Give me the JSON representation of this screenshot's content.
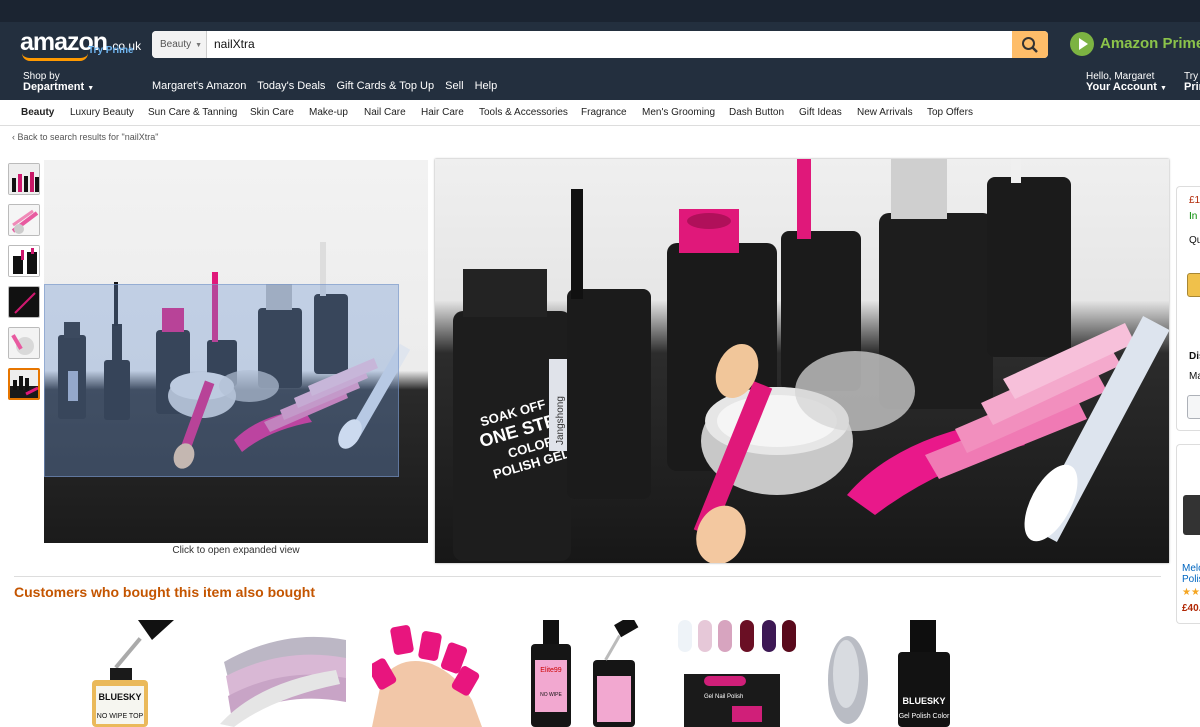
{
  "header": {
    "logo_text": "amazon",
    "logo_tld": ".co.uk",
    "try_prime": "Try Prime",
    "search_category": "Beauty",
    "search_query": "nailXtra",
    "prime_label": "Amazon Prime",
    "shop_by_small": "Shop by",
    "shop_by_big": "Department",
    "nav_links": [
      "Margaret's Amazon",
      "Today's Deals",
      "Gift Cards & Top Up",
      "Sell",
      "Help"
    ],
    "account_small": "Hello, Margaret",
    "account_big": "Your Account",
    "try_small": "Try",
    "try_big": "Prime"
  },
  "subnav": [
    "Beauty",
    "Luxury Beauty",
    "Sun Care & Tanning",
    "Skin Care",
    "Make-up",
    "Nail Care",
    "Hair Care",
    "Tools & Accessories",
    "Fragrance",
    "Men's Grooming",
    "Dash Button",
    "Gift Ideas",
    "New Arrivals",
    "Top Offers"
  ],
  "breadcrumb": "‹  Back to search results for \"nailXtra\"",
  "product": {
    "click_to_expand": "Click to open expanded view",
    "bottle_label_line1": "SOAK OFF",
    "bottle_label_line2": "ONE STEP",
    "bottle_label_line3": "COLOR",
    "bottle_label_line4": "POLISH GEL",
    "bottle_brand": "Jangshong"
  },
  "buybox": {
    "price": "£1",
    "stock": "In",
    "qty": "Qu",
    "d1": "Dis",
    "d2": "Ma"
  },
  "ad": {
    "title1": "Melo",
    "title2": "Polis",
    "price": "£40."
  },
  "customers_title": "Customers who bought this item also bought",
  "recs": [
    {
      "brand": "BLUESKY",
      "sub": "NO WIPE TOP"
    },
    {
      "brand": "",
      "sub": ""
    },
    {
      "brand": "",
      "sub": ""
    },
    {
      "brand": "Elite99",
      "sub": "NO WIPE"
    },
    {
      "brand": "Gel Nail Polish",
      "sub": ""
    },
    {
      "brand": "BLUESKY",
      "sub": "Gel Polish Color"
    }
  ],
  "colors": {
    "header": "#232f3e",
    "accent": "#febd69",
    "section_title": "#c45500",
    "prime_green": "#8bc34a"
  }
}
